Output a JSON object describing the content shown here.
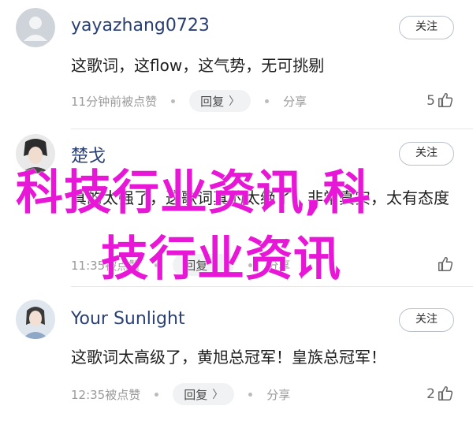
{
  "comments": [
    {
      "username": "yayazhang0723",
      "follow_label": "关注",
      "text": "这歌词，这flow，这气势，无可挑剔",
      "time": "11分钟前被点赞",
      "reply_label": "回复",
      "share_label": "分享",
      "likes": "5",
      "avatar": "default-avatar-icon"
    },
    {
      "username": "楚戈",
      "follow_label": "关注",
      "text": "真的太强了，这歌词真的太绝了，非常真实，太有态度",
      "time": "11:35被点赞",
      "reply_label": "回复",
      "share_label": "分享",
      "likes": "",
      "avatar": "user-photo-avatar"
    },
    {
      "username": "Your Sunlight",
      "follow_label": "关注",
      "text": "这歌词太高级了，黄旭总冠军！皇族总冠军！",
      "time": "12:35被点赞",
      "reply_label": "回复",
      "share_label": "分享",
      "likes": "2",
      "avatar": "user-photo-avatar"
    }
  ],
  "watermark": {
    "line1": "科技行业资讯,科",
    "line2": "技行业资讯",
    "color": "#e816d6"
  }
}
